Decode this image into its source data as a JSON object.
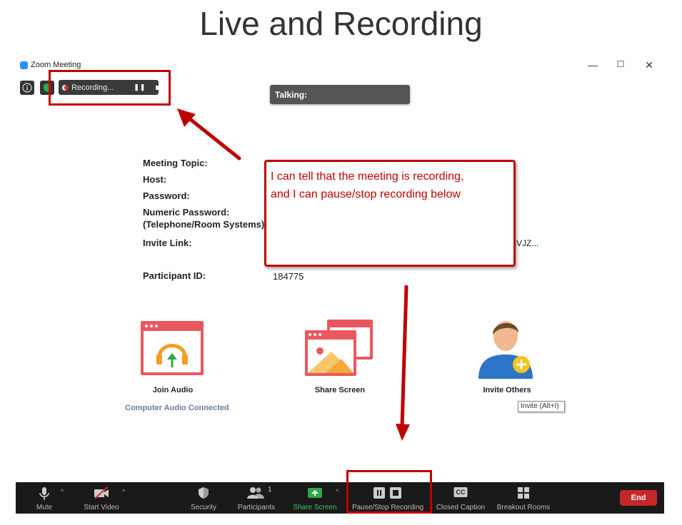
{
  "slide": {
    "title": "Live and Recording"
  },
  "window": {
    "title": "Zoom Meeting",
    "controls": {
      "minimize": "—",
      "maximize": "☐",
      "close": "✕"
    }
  },
  "top_bar": {
    "recording_label": "Recording...",
    "talking_label": "Talking:"
  },
  "meeting_info": {
    "labels": {
      "topic": "Meeting Topic:",
      "host": "Host:",
      "password": "Password:",
      "numeric_password_1": "Numeric Password:",
      "numeric_password_2": "(Telephone/Room Systems)",
      "invite_link": "Invite Link:",
      "participant_id": "Participant ID:"
    },
    "invite_link_fragment": "sVJZ...",
    "participant_id": "184775"
  },
  "callout": {
    "line1": "I can tell that the meeting is recording,",
    "line2": "and I can pause/stop recording below"
  },
  "tiles": {
    "join_audio": "Join Audio",
    "audio_status": "Computer Audio Connected",
    "share_screen": "Share Screen",
    "invite_others": "Invite Others",
    "invite_tooltip": "Invite (Alt+I)"
  },
  "toolbar": {
    "mute": "Mute",
    "start_video": "Start Video",
    "security": "Security",
    "participants": "Participants",
    "participants_count": "1",
    "share_screen": "Share Screen",
    "pause_stop_recording": "Pause/Stop Recording",
    "closed_caption": "Closed Caption",
    "cc_glyph": "CC",
    "breakout_rooms": "Breakout Rooms",
    "end": "End"
  },
  "colors": {
    "annotation_red": "#c00000",
    "toolbar_bg": "#1a1a1a",
    "end_button": "#c62828",
    "share_green": "#2ea84a",
    "tile_red": "#e8585e"
  }
}
